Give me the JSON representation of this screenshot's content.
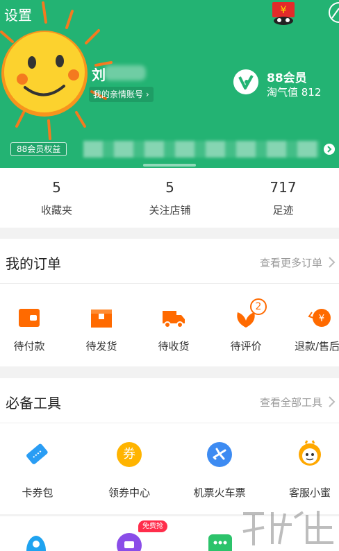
{
  "header": {
    "settings_label": "设置",
    "username": "刘",
    "family_account": "我的亲情账号 ›",
    "vip_title": "88会员",
    "vip_score": "淘气值 812",
    "vip_rights": "88会员权益",
    "bg_color": "#23b373"
  },
  "stats": [
    {
      "value": "5",
      "label": "收藏夹"
    },
    {
      "value": "5",
      "label": "关注店铺"
    },
    {
      "value": "717",
      "label": "足迹"
    }
  ],
  "orders": {
    "title": "我的订单",
    "more": "查看更多订单",
    "items": [
      {
        "label": "待付款",
        "icon": "wallet-icon"
      },
      {
        "label": "待发货",
        "icon": "package-icon"
      },
      {
        "label": "待收货",
        "icon": "truck-icon"
      },
      {
        "label": "待评价",
        "icon": "review-icon",
        "badge": "2"
      },
      {
        "label": "退款/售后",
        "icon": "refund-icon"
      }
    ]
  },
  "tools": {
    "title": "必备工具",
    "more": "查看全部工具",
    "items": [
      {
        "label": "卡券包",
        "icon": "ticket-icon"
      },
      {
        "label": "领券中心",
        "icon": "coupon-icon",
        "glyph": "券"
      },
      {
        "label": "机票火车票",
        "icon": "airplane-icon"
      },
      {
        "label": "客服小蜜",
        "icon": "customer-service-icon"
      }
    ],
    "free_badge": "免费抢"
  },
  "colors": {
    "accent_orange": "#ff6a00",
    "badge_red": "#ff2d4b"
  }
}
